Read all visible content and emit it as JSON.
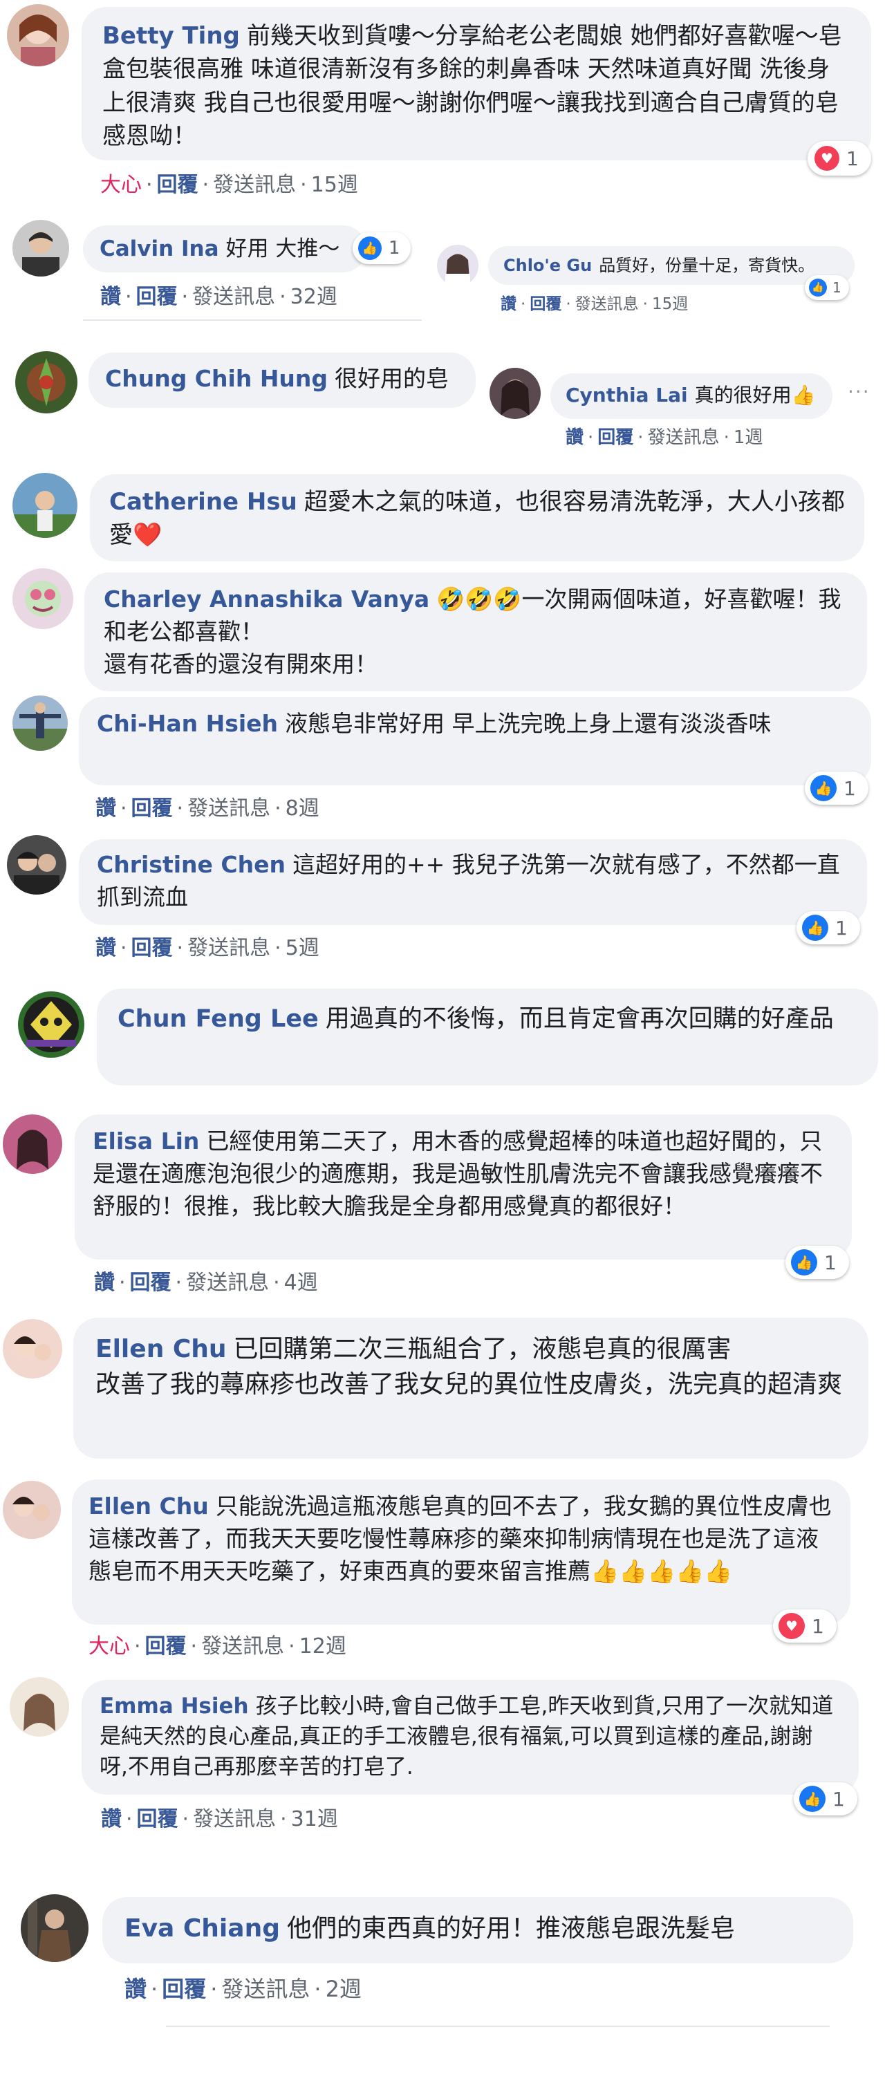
{
  "comments": [
    {
      "author": "Betty Ting",
      "text": "前幾天收到貨嘍～分享給老公老闆娘 她們都好喜歡喔～皂盒包裝很高雅 味道很清新沒有多餘的刺鼻香味 天然味道真好聞 洗後身上很清爽 我自己也很愛用喔～謝謝你們喔～讓我找到適合自己膚質的皂 感恩呦！",
      "action": "大心",
      "reply": "回覆",
      "message": "發送訊息",
      "time": "15週",
      "reaction_count": "1"
    },
    {
      "author": "Calvin Ina",
      "text": "好用 大推～",
      "action": "讚",
      "reply": "回覆",
      "message": "發送訊息",
      "time": "32週",
      "reaction_count": "1"
    },
    {
      "author": "Chlo'e Gu",
      "text": "品質好，份量十足，寄貨快。",
      "action": "讚",
      "reply": "回覆",
      "message": "發送訊息",
      "time": "15週",
      "reaction_count": "1"
    },
    {
      "author": "Chung Chih Hung",
      "text": "很好用的皂"
    },
    {
      "author": "Cynthia Lai",
      "text": "真的很好用👍",
      "action": "讚",
      "reply": "回覆",
      "message": "發送訊息",
      "time": "1週"
    },
    {
      "author": "Catherine Hsu",
      "text": "超愛木之氣的味道，也很容易清洗乾淨，大人小孩都愛❤️"
    },
    {
      "author": "Charley Annashika Vanya",
      "text": "🤣🤣🤣一次開兩個味道，好喜歡喔！我和老公都喜歡！",
      "text2": "還有花香的還沒有開來用！"
    },
    {
      "author": "Chi-Han Hsieh",
      "text": "液態皂非常好用 早上洗完晚上身上還有淡淡香味",
      "action": "讚",
      "reply": "回覆",
      "message": "發送訊息",
      "time": "8週",
      "reaction_count": "1"
    },
    {
      "author": "Christine Chen",
      "text": "這超好用的++ 我兒子洗第一次就有感了，不然都一直抓到流血",
      "action": "讚",
      "reply": "回覆",
      "message": "發送訊息",
      "time": "5週",
      "reaction_count": "1"
    },
    {
      "author": "Chun Feng Lee",
      "text": "用過真的不後悔，而且肯定會再次回購的好產品"
    },
    {
      "author": "Elisa Lin",
      "text": "已經使用第二天了，用木香的感覺超棒的味道也超好聞的，只是還在適應泡泡很少的適應期，我是過敏性肌膚洗完不會讓我感覺癢癢不舒服的！很推，我比較大膽我是全身都用感覺真的都很好！",
      "action": "讚",
      "reply": "回覆",
      "message": "發送訊息",
      "time": "4週",
      "reaction_count": "1"
    },
    {
      "author": "Ellen Chu",
      "text": "已回購第二次三瓶組合了，液態皂真的很厲害",
      "text2": "改善了我的蕁麻疹也改善了我女兒的異位性皮膚炎，洗完真的超清爽"
    },
    {
      "author": "Ellen Chu",
      "text": "只能說洗過這瓶液態皂真的回不去了，我女鵝的異位性皮膚也這樣改善了，而我天天要吃慢性蕁麻疹的藥來抑制病情現在也是洗了這液態皂而不用天天吃藥了，好東西真的要來留言推薦👍👍👍👍👍",
      "action": "大心",
      "reply": "回覆",
      "message": "發送訊息",
      "time": "12週",
      "reaction_count": "1"
    },
    {
      "author": "Emma Hsieh",
      "text": "孩子比較小時,會自己做手工皂,昨天收到貨,只用了一次就知道是純天然的良心產品,真正的手工液體皂,很有福氣,可以買到這樣的產品,謝謝呀,不用自己再那麼辛苦的打皂了.",
      "action": "讚",
      "reply": "回覆",
      "message": "發送訊息",
      "time": "31週",
      "reaction_count": "1"
    },
    {
      "author": "Eva Chiang",
      "text": "他們的東西真的好用！推液態皂跟洗髮皂",
      "action": "讚",
      "reply": "回覆",
      "message": "發送訊息",
      "time": "2週"
    }
  ],
  "more_icon": "more-horizontal-icon",
  "colors": {
    "author": "#365899",
    "bubble": "#f0f2f5",
    "like": "#1877f2",
    "love": "#e0245e",
    "meta": "#606770"
  }
}
